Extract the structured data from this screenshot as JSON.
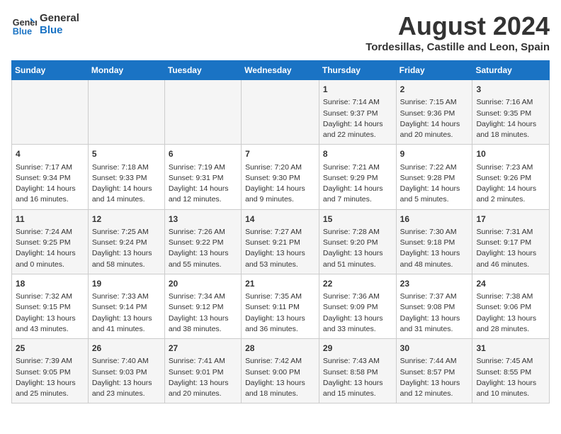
{
  "header": {
    "logo_line1": "General",
    "logo_line2": "Blue",
    "month": "August 2024",
    "location": "Tordesillas, Castille and Leon, Spain"
  },
  "weekdays": [
    "Sunday",
    "Monday",
    "Tuesday",
    "Wednesday",
    "Thursday",
    "Friday",
    "Saturday"
  ],
  "weeks": [
    [
      {
        "day": "",
        "info": ""
      },
      {
        "day": "",
        "info": ""
      },
      {
        "day": "",
        "info": ""
      },
      {
        "day": "",
        "info": ""
      },
      {
        "day": "1",
        "info": "Sunrise: 7:14 AM\nSunset: 9:37 PM\nDaylight: 14 hours\nand 22 minutes."
      },
      {
        "day": "2",
        "info": "Sunrise: 7:15 AM\nSunset: 9:36 PM\nDaylight: 14 hours\nand 20 minutes."
      },
      {
        "day": "3",
        "info": "Sunrise: 7:16 AM\nSunset: 9:35 PM\nDaylight: 14 hours\nand 18 minutes."
      }
    ],
    [
      {
        "day": "4",
        "info": "Sunrise: 7:17 AM\nSunset: 9:34 PM\nDaylight: 14 hours\nand 16 minutes."
      },
      {
        "day": "5",
        "info": "Sunrise: 7:18 AM\nSunset: 9:33 PM\nDaylight: 14 hours\nand 14 minutes."
      },
      {
        "day": "6",
        "info": "Sunrise: 7:19 AM\nSunset: 9:31 PM\nDaylight: 14 hours\nand 12 minutes."
      },
      {
        "day": "7",
        "info": "Sunrise: 7:20 AM\nSunset: 9:30 PM\nDaylight: 14 hours\nand 9 minutes."
      },
      {
        "day": "8",
        "info": "Sunrise: 7:21 AM\nSunset: 9:29 PM\nDaylight: 14 hours\nand 7 minutes."
      },
      {
        "day": "9",
        "info": "Sunrise: 7:22 AM\nSunset: 9:28 PM\nDaylight: 14 hours\nand 5 minutes."
      },
      {
        "day": "10",
        "info": "Sunrise: 7:23 AM\nSunset: 9:26 PM\nDaylight: 14 hours\nand 2 minutes."
      }
    ],
    [
      {
        "day": "11",
        "info": "Sunrise: 7:24 AM\nSunset: 9:25 PM\nDaylight: 14 hours\nand 0 minutes."
      },
      {
        "day": "12",
        "info": "Sunrise: 7:25 AM\nSunset: 9:24 PM\nDaylight: 13 hours\nand 58 minutes."
      },
      {
        "day": "13",
        "info": "Sunrise: 7:26 AM\nSunset: 9:22 PM\nDaylight: 13 hours\nand 55 minutes."
      },
      {
        "day": "14",
        "info": "Sunrise: 7:27 AM\nSunset: 9:21 PM\nDaylight: 13 hours\nand 53 minutes."
      },
      {
        "day": "15",
        "info": "Sunrise: 7:28 AM\nSunset: 9:20 PM\nDaylight: 13 hours\nand 51 minutes."
      },
      {
        "day": "16",
        "info": "Sunrise: 7:30 AM\nSunset: 9:18 PM\nDaylight: 13 hours\nand 48 minutes."
      },
      {
        "day": "17",
        "info": "Sunrise: 7:31 AM\nSunset: 9:17 PM\nDaylight: 13 hours\nand 46 minutes."
      }
    ],
    [
      {
        "day": "18",
        "info": "Sunrise: 7:32 AM\nSunset: 9:15 PM\nDaylight: 13 hours\nand 43 minutes."
      },
      {
        "day": "19",
        "info": "Sunrise: 7:33 AM\nSunset: 9:14 PM\nDaylight: 13 hours\nand 41 minutes."
      },
      {
        "day": "20",
        "info": "Sunrise: 7:34 AM\nSunset: 9:12 PM\nDaylight: 13 hours\nand 38 minutes."
      },
      {
        "day": "21",
        "info": "Sunrise: 7:35 AM\nSunset: 9:11 PM\nDaylight: 13 hours\nand 36 minutes."
      },
      {
        "day": "22",
        "info": "Sunrise: 7:36 AM\nSunset: 9:09 PM\nDaylight: 13 hours\nand 33 minutes."
      },
      {
        "day": "23",
        "info": "Sunrise: 7:37 AM\nSunset: 9:08 PM\nDaylight: 13 hours\nand 31 minutes."
      },
      {
        "day": "24",
        "info": "Sunrise: 7:38 AM\nSunset: 9:06 PM\nDaylight: 13 hours\nand 28 minutes."
      }
    ],
    [
      {
        "day": "25",
        "info": "Sunrise: 7:39 AM\nSunset: 9:05 PM\nDaylight: 13 hours\nand 25 minutes."
      },
      {
        "day": "26",
        "info": "Sunrise: 7:40 AM\nSunset: 9:03 PM\nDaylight: 13 hours\nand 23 minutes."
      },
      {
        "day": "27",
        "info": "Sunrise: 7:41 AM\nSunset: 9:01 PM\nDaylight: 13 hours\nand 20 minutes."
      },
      {
        "day": "28",
        "info": "Sunrise: 7:42 AM\nSunset: 9:00 PM\nDaylight: 13 hours\nand 18 minutes."
      },
      {
        "day": "29",
        "info": "Sunrise: 7:43 AM\nSunset: 8:58 PM\nDaylight: 13 hours\nand 15 minutes."
      },
      {
        "day": "30",
        "info": "Sunrise: 7:44 AM\nSunset: 8:57 PM\nDaylight: 13 hours\nand 12 minutes."
      },
      {
        "day": "31",
        "info": "Sunrise: 7:45 AM\nSunset: 8:55 PM\nDaylight: 13 hours\nand 10 minutes."
      }
    ]
  ]
}
